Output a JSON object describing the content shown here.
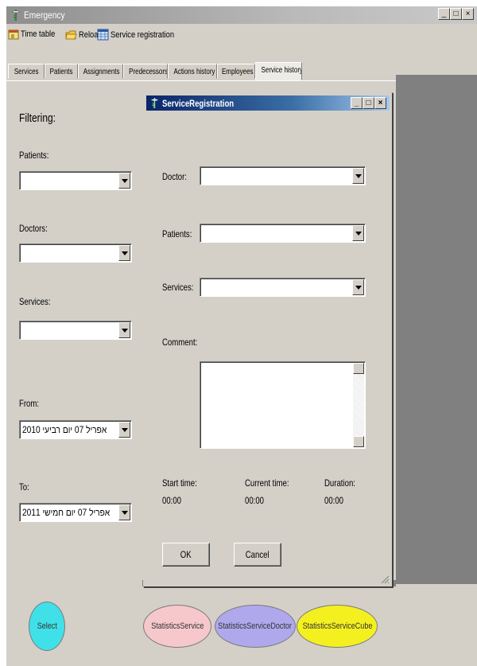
{
  "app": {
    "title": "Emergency",
    "window_buttons": [
      "_",
      "□",
      "×"
    ]
  },
  "toolbar": {
    "items": [
      {
        "label": "Time table",
        "icon": "calendar-icon"
      },
      {
        "label": "Reload",
        "icon": "folder-icon"
      },
      {
        "label": "Service registration",
        "icon": "grid-icon"
      }
    ]
  },
  "tabs": [
    "Services",
    "Patients",
    "Assignments",
    "Predecessors",
    "Actions history",
    "Employees",
    "Service history"
  ],
  "active_tab": "Service history",
  "filter": {
    "heading": "Filtering:",
    "patients_label": "Patients:",
    "patients_value": "",
    "doctors_label": "Doctors:",
    "doctors_value": "",
    "services_label": "Services:",
    "services_value": "",
    "from_label": "From:",
    "from_value": "2010  אפריל 07 יום רביעי",
    "to_label": "To:",
    "to_value": "2011  אפריל 07 יום חמישי"
  },
  "dialog": {
    "title": "ServiceRegistration",
    "doctor_label": "Doctor:",
    "doctor_value": "",
    "patients_label": "Patients:",
    "patients_value": "",
    "services_label": "Services:",
    "services_value": "",
    "comment_label": "Comment:",
    "comment_value": "",
    "start_time_label": "Start time:",
    "start_time_value": "00:00",
    "current_time_label": "Current time:",
    "current_time_value": "00:00",
    "duration_label": "Duration:",
    "duration_value": "00:00",
    "ok_label": "OK",
    "cancel_label": "Cancel"
  },
  "bottom_buttons": {
    "select": "Select",
    "statistics_service": "StatisticsService",
    "statistics_service_doctor": "StatisticsServiceDoctor",
    "statistics_service_cube": "StatisticsServiceCube"
  },
  "colors": {
    "select": "#40e0e8",
    "statistics_service": "#f6c8cc",
    "statistics_service_doctor": "#b0a8ec",
    "statistics_service_cube": "#f4f020",
    "dialog_title": "#0a246a"
  }
}
